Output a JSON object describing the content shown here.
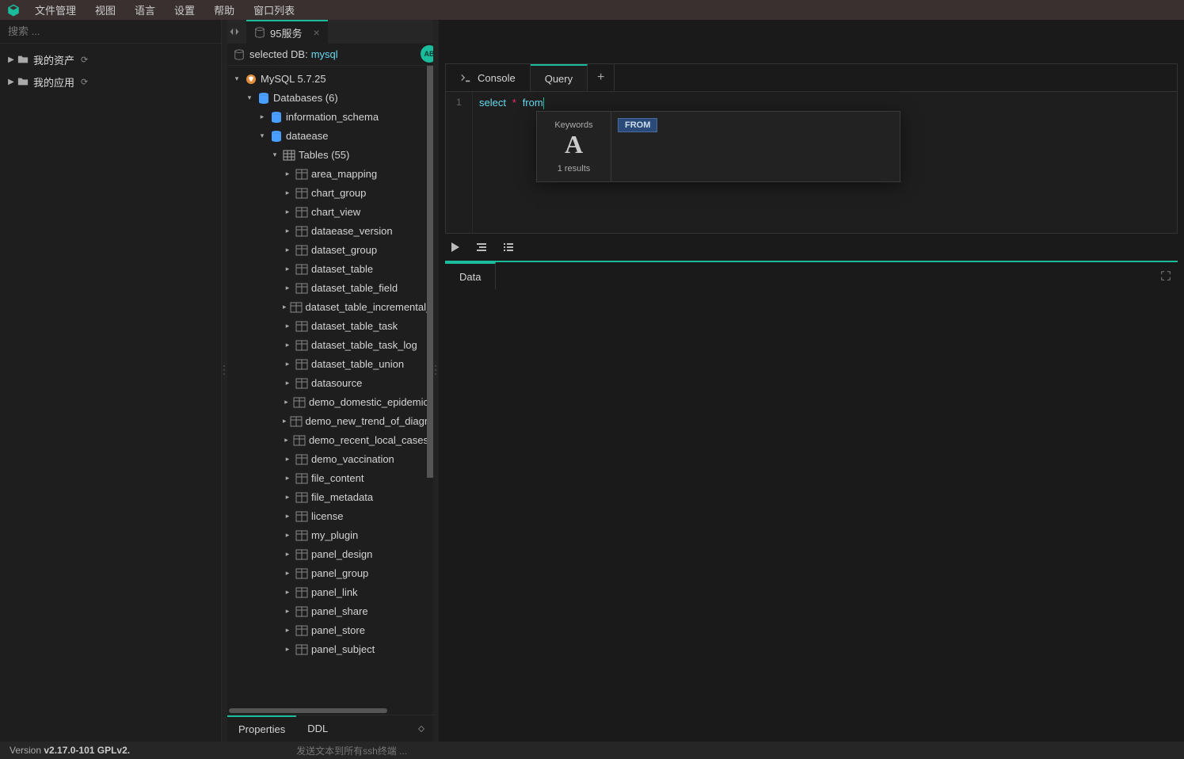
{
  "topbar": {
    "menus": [
      "文件管理",
      "视图",
      "语言",
      "设置",
      "帮助",
      "窗口列表"
    ]
  },
  "sidebar": {
    "search_placeholder": "搜索 ...",
    "items": [
      {
        "label": "我的资产",
        "refresh": true
      },
      {
        "label": "我的应用",
        "refresh": true
      }
    ]
  },
  "dbpanel": {
    "tab_label": "95服务",
    "selected_prefix": "selected DB:",
    "selected_db": "mysql",
    "ab_badge": "AB",
    "root": {
      "label": "MySQL 5.7.25"
    },
    "databases_label": "Databases (6)",
    "db_items": [
      "information_schema",
      "dataease"
    ],
    "tables_label": "Tables (55)",
    "tables": [
      "area_mapping",
      "chart_group",
      "chart_view",
      "dataease_version",
      "dataset_group",
      "dataset_table",
      "dataset_table_field",
      "dataset_table_incremental_config",
      "dataset_table_task",
      "dataset_table_task_log",
      "dataset_table_union",
      "datasource",
      "demo_domestic_epidemic",
      "demo_new_trend_of_diagnosis",
      "demo_recent_local_cases",
      "demo_vaccination",
      "file_content",
      "file_metadata",
      "license",
      "my_plugin",
      "panel_design",
      "panel_group",
      "panel_link",
      "panel_share",
      "panel_store",
      "panel_subject"
    ],
    "footer": {
      "properties": "Properties",
      "ddl": "DDL"
    }
  },
  "editor": {
    "tabs": {
      "console": "Console",
      "query": "Query"
    },
    "line": "1",
    "sql": {
      "select": "select",
      "star": "*",
      "from": "from"
    },
    "ac": {
      "keywords": "Keywords",
      "letter": "A",
      "results": "1 results",
      "chip": "FROM"
    }
  },
  "results": {
    "data": "Data"
  },
  "status": {
    "version_prefix": "Version ",
    "version": "v2.17.0-101 GPLv2.",
    "ssh": "发送文本到所有ssh终端 ..."
  }
}
